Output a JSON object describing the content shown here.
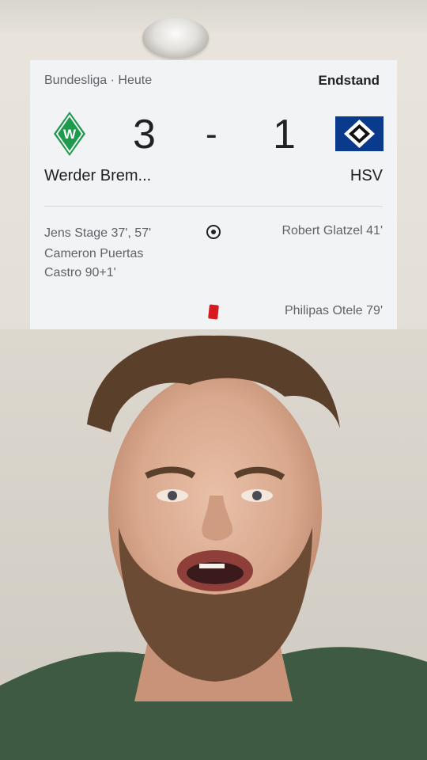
{
  "header": {
    "competition": "Bundesliga · Heute",
    "status": "Endstand"
  },
  "match": {
    "home_team": "Werder Brem...",
    "away_team": "HSV",
    "home_score": "3",
    "separator": "-",
    "away_score": "1"
  },
  "events": {
    "home_goals": [
      "Jens Stage 37', 57'",
      "Cameron Puertas Castro 90+1'"
    ],
    "away_goals": [
      "Robert Glatzel 41'"
    ],
    "away_cards": [
      "Philipas Otele 79'"
    ]
  },
  "colors": {
    "card_bg": "#f1f3f5",
    "werder_green": "#1d9a4b",
    "hsv_blue": "#0a3a8c",
    "red_card": "#d71920"
  },
  "icons": {
    "goal": "soccer-ball-icon",
    "red_card": "red-card-icon"
  }
}
